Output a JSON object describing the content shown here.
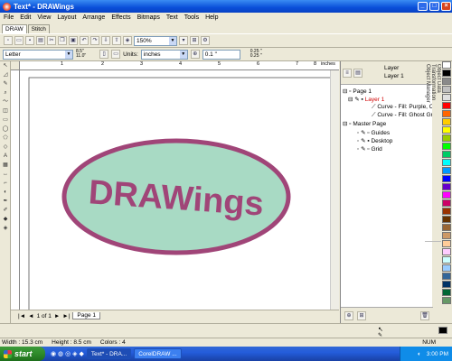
{
  "window": {
    "title": "Text* - DRAWings",
    "min_label": "_",
    "max_label": "□",
    "close_label": "×"
  },
  "menu": [
    "File",
    "Edit",
    "View",
    "Layout",
    "Arrange",
    "Effects",
    "Bitmaps",
    "Text",
    "Tools",
    "Help"
  ],
  "tabs": [
    "DRAW",
    "Stitch"
  ],
  "toolbar": {
    "zoom": "150%"
  },
  "propbar": {
    "paper": "Letter",
    "width_val": "8.5\"",
    "height_val": "11.0\"",
    "units_label": "Units:",
    "units_value": "inches",
    "nudge": "0.1 \"",
    "dup_x": "0.25 \"",
    "dup_y": "0.25 \""
  },
  "hruler": {
    "ticks": [
      "1",
      "2",
      "3",
      "4",
      "5",
      "6",
      "7",
      "8"
    ],
    "unit": "inches"
  },
  "canvas": {
    "logo_text": "DRAWings",
    "fill_color": "#A8DAC4",
    "outline_color": "#A04578",
    "text_color": "#A04578"
  },
  "pagebar": {
    "nav_first": "|◄",
    "nav_prev": "◄",
    "page_of": "1 of 1",
    "nav_next": "►",
    "nav_last": "►|",
    "page_tab": "Page 1"
  },
  "docker": {
    "header_title": "Layer",
    "header_sub": "Layer 1",
    "tree": [
      {
        "label": "Page 1",
        "color": "#000"
      },
      {
        "label": "Layer 1",
        "color": "#D00000"
      },
      {
        "label": "Curve - Fill: Purple, Ou",
        "color": "#000"
      },
      {
        "label": "Curve - Fill: Ghost Gree",
        "color": "#000"
      },
      {
        "label": "Master Page",
        "color": "#000"
      },
      {
        "label": "Guides",
        "color": "#000"
      },
      {
        "label": "Desktop",
        "color": "#000"
      },
      {
        "label": "Grid",
        "color": "#000"
      }
    ]
  },
  "sidetabs": [
    "Object Data",
    "Transformation",
    "Object Manager"
  ],
  "palette": [
    "#FFFFFF",
    "#000000",
    "#8A8A8A",
    "#C0C0C0",
    "#E0E0E0",
    "#FF0000",
    "#FF6600",
    "#FFCC00",
    "#FFFF00",
    "#99CC00",
    "#00FF00",
    "#00CC66",
    "#00FFFF",
    "#0099FF",
    "#0000FF",
    "#6600CC",
    "#FF00FF",
    "#CC0066",
    "#993300",
    "#663300",
    "#996633",
    "#CC9966",
    "#FFCC99",
    "#FFCCFF",
    "#CCFFFF",
    "#99CCFF",
    "#336699",
    "#003366",
    "#006633",
    "#669966"
  ],
  "status": {
    "width": "Width : 15.3 cm",
    "height": "Height : 8.5 cm",
    "colors": "Colors : 4",
    "mode": "NUM"
  },
  "taskbar": {
    "start": "start",
    "items": [
      "Text* - DRA...",
      "CorelDRAW ..."
    ],
    "time": "3:00 PM"
  }
}
